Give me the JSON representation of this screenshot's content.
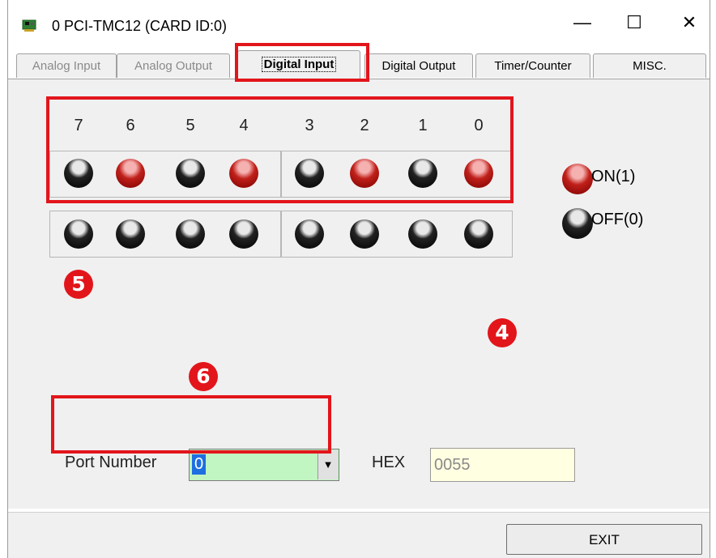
{
  "window": {
    "title": "0 PCI-TMC12 (CARD ID:0)",
    "minimize": "—",
    "maximize": "☐",
    "close": "✕"
  },
  "tabs": [
    {
      "label": "Analog Input",
      "state": "disabled"
    },
    {
      "label": "Analog Output",
      "state": "disabled"
    },
    {
      "label": "Digital Input",
      "state": "active"
    },
    {
      "label": "Digital Output",
      "state": "normal"
    },
    {
      "label": "Timer/Counter",
      "state": "normal"
    },
    {
      "label": "MISC.",
      "state": "normal"
    }
  ],
  "digital_input": {
    "bit_labels": [
      "7",
      "6",
      "5",
      "4",
      "3",
      "2",
      "1",
      "0"
    ],
    "row1_states": [
      "off",
      "on",
      "off",
      "on",
      "off",
      "on",
      "off",
      "on"
    ],
    "row2_states": [
      "off",
      "off",
      "off",
      "off",
      "off",
      "off",
      "off",
      "off"
    ]
  },
  "legend": {
    "on_label": "ON(1)",
    "off_label": "OFF(0)"
  },
  "callouts": {
    "four": "4",
    "five": "5",
    "six": "6"
  },
  "port": {
    "label": "Port Number",
    "value": "0",
    "dropdown_arrow": "▼"
  },
  "hex": {
    "label": "HEX",
    "value": "0055"
  },
  "exit_label": "EXIT",
  "colors": {
    "led_on": "#c0201a",
    "led_off": "#000000",
    "annotation_red": "#e2151b",
    "port_bg": "#c1f5c1",
    "hex_bg": "#ffffe1"
  }
}
